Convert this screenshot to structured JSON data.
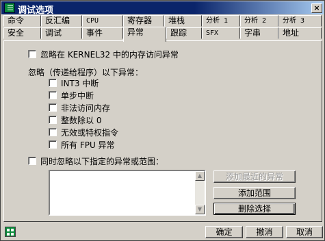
{
  "window": {
    "title": "调试选项"
  },
  "tabs_row1": [
    "命令",
    "反汇编",
    "CPU",
    "寄存器",
    "堆栈",
    "分析 1",
    "分析 2",
    "分析 3"
  ],
  "tabs_row2": [
    "安全",
    "调试",
    "事件",
    "异常",
    "跟踪",
    "SFX",
    "字串",
    "地址"
  ],
  "active_tab": "异常",
  "options": {
    "ignore_kernel32": "忽略在 KERNEL32 中的内存访问异常",
    "ignore_group_label": "忽略（传递给程序）以下异常：",
    "exceptions": [
      "INT3 中断",
      "单步中断",
      "非法访问内存",
      "整数除以 0",
      "无效或特权指令",
      "所有 FPU 异常"
    ],
    "also_ignore_range": "同时忽略以下指定的异常或范围："
  },
  "range_buttons": {
    "add_last": "添加最近的异常",
    "add_range": "添加范围",
    "delete": "删除选择"
  },
  "footer": {
    "ok": "确定",
    "cancel_undo": "撤消",
    "cancel": "取消"
  }
}
